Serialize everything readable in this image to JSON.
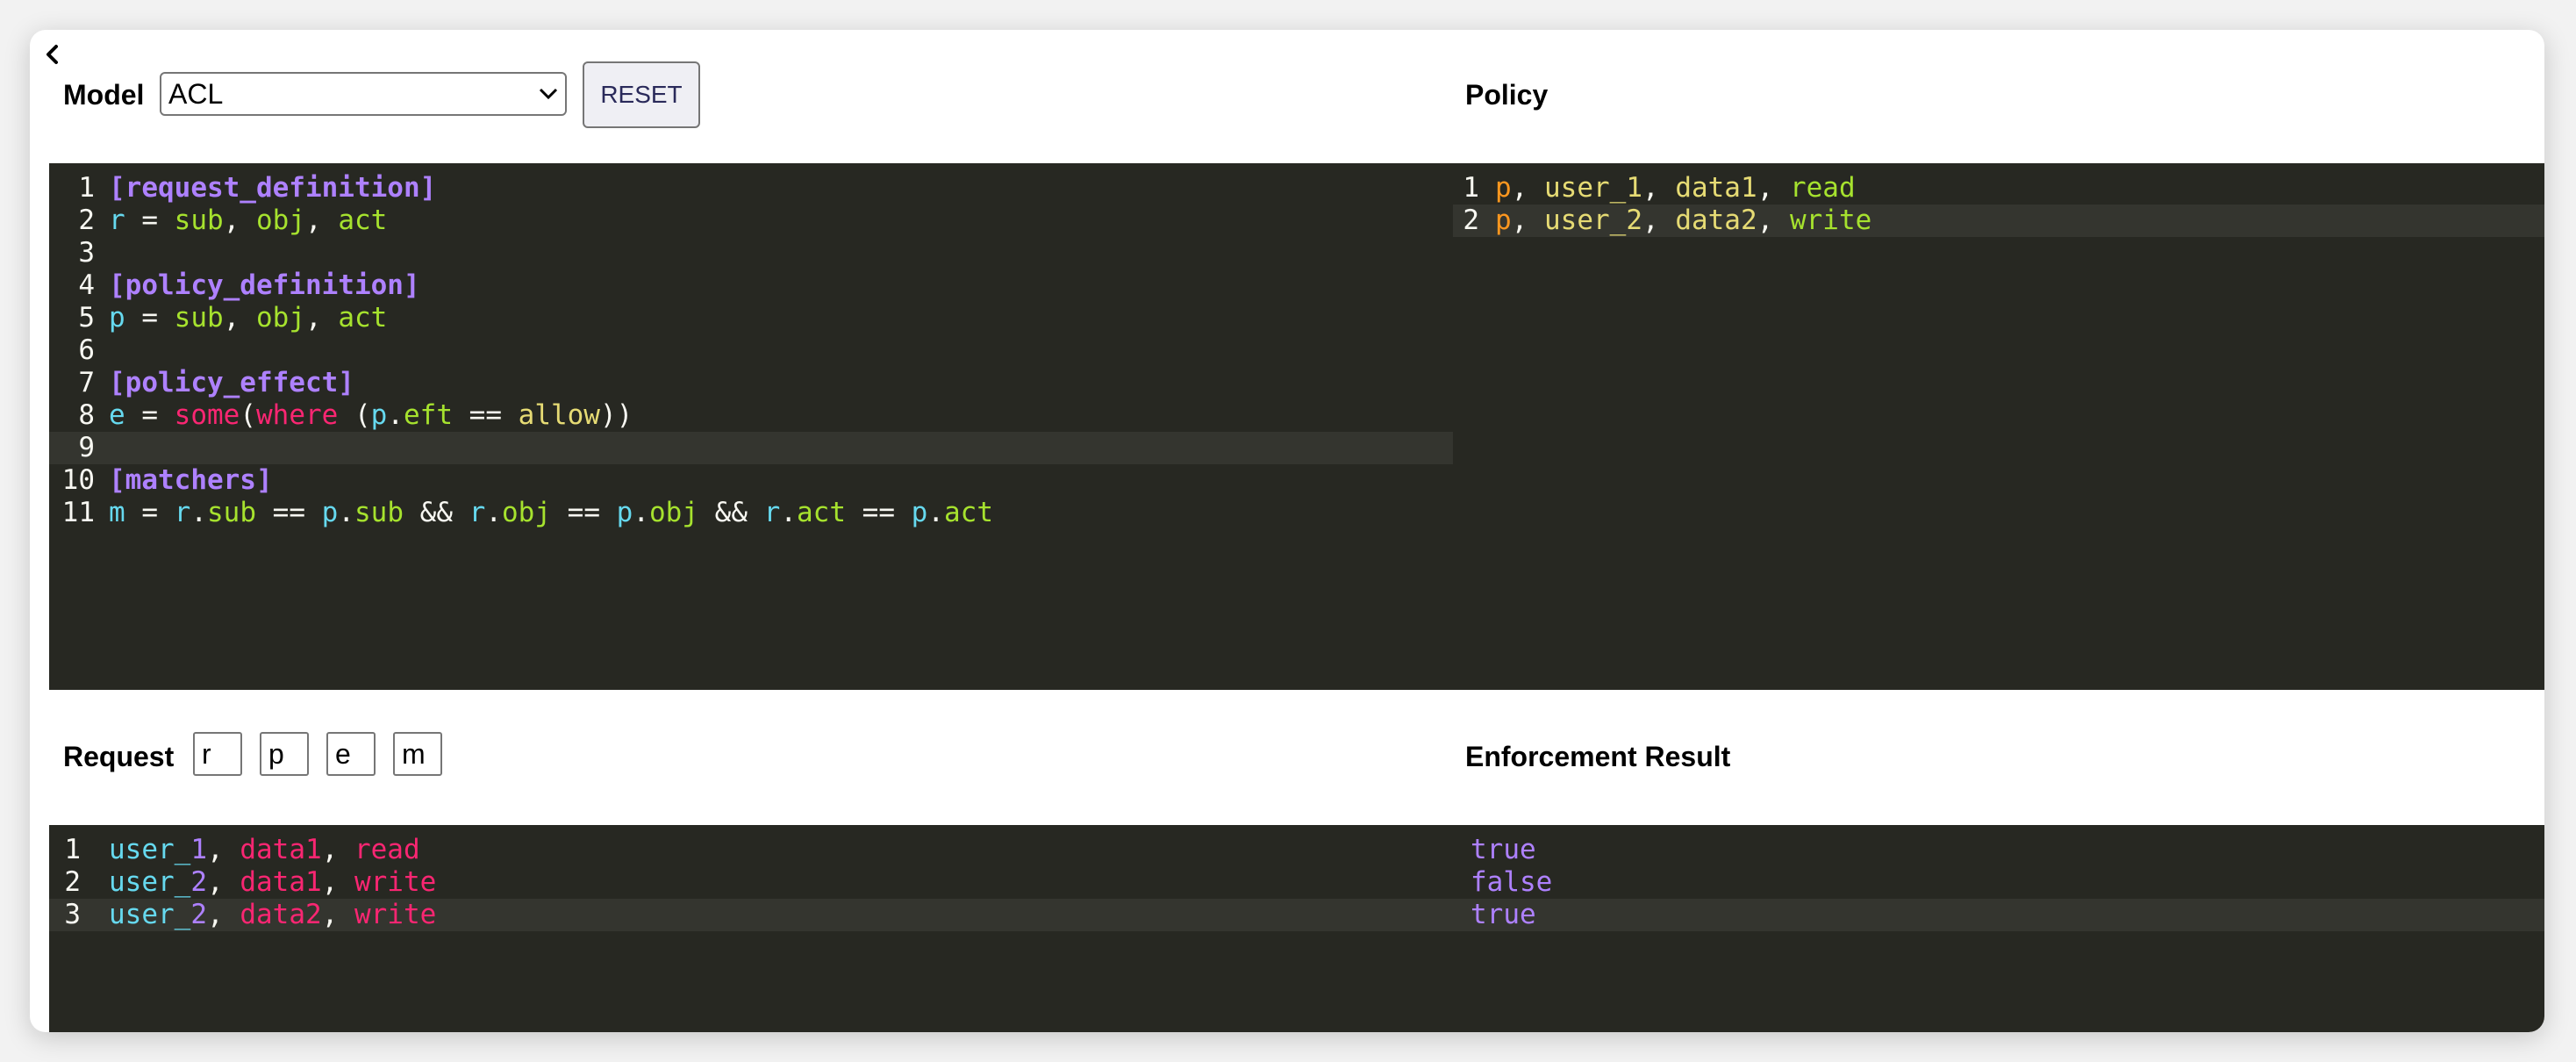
{
  "header": {
    "model_label": "Model",
    "model_selected": "ACL",
    "reset_label": "RESET",
    "policy_label": "Policy"
  },
  "model_editor": {
    "lines": [
      {
        "num": "1",
        "tokens": [
          {
            "t": "[request_definition]",
            "c": "sec"
          }
        ]
      },
      {
        "num": "2",
        "tokens": [
          {
            "t": "r",
            "c": "c"
          },
          {
            "t": " = ",
            "c": ""
          },
          {
            "t": "sub",
            "c": "g"
          },
          {
            "t": ", ",
            "c": ""
          },
          {
            "t": "obj",
            "c": "g"
          },
          {
            "t": ", ",
            "c": ""
          },
          {
            "t": "act",
            "c": "g"
          }
        ]
      },
      {
        "num": "3",
        "tokens": []
      },
      {
        "num": "4",
        "tokens": [
          {
            "t": "[policy_definition]",
            "c": "sec"
          }
        ]
      },
      {
        "num": "5",
        "tokens": [
          {
            "t": "p",
            "c": "c"
          },
          {
            "t": " = ",
            "c": ""
          },
          {
            "t": "sub",
            "c": "g"
          },
          {
            "t": ", ",
            "c": ""
          },
          {
            "t": "obj",
            "c": "g"
          },
          {
            "t": ", ",
            "c": ""
          },
          {
            "t": "act",
            "c": "g"
          }
        ]
      },
      {
        "num": "6",
        "tokens": []
      },
      {
        "num": "7",
        "tokens": [
          {
            "t": "[policy_effect]",
            "c": "sec"
          }
        ]
      },
      {
        "num": "8",
        "tokens": [
          {
            "t": "e",
            "c": "c"
          },
          {
            "t": " = ",
            "c": ""
          },
          {
            "t": "some",
            "c": "pink"
          },
          {
            "t": "(",
            "c": ""
          },
          {
            "t": "where",
            "c": "pink"
          },
          {
            "t": " (",
            "c": ""
          },
          {
            "t": "p",
            "c": "c"
          },
          {
            "t": ".",
            "c": ""
          },
          {
            "t": "eft",
            "c": "g"
          },
          {
            "t": " == ",
            "c": ""
          },
          {
            "t": "allow",
            "c": "y"
          },
          {
            "t": "))",
            "c": ""
          }
        ]
      },
      {
        "num": "9",
        "tokens": [],
        "active": true
      },
      {
        "num": "10",
        "tokens": [
          {
            "t": "[matchers]",
            "c": "sec"
          }
        ]
      },
      {
        "num": "11",
        "tokens": [
          {
            "t": "m",
            "c": "c"
          },
          {
            "t": " = ",
            "c": ""
          },
          {
            "t": "r",
            "c": "c"
          },
          {
            "t": ".",
            "c": ""
          },
          {
            "t": "sub",
            "c": "g"
          },
          {
            "t": " == ",
            "c": ""
          },
          {
            "t": "p",
            "c": "c"
          },
          {
            "t": ".",
            "c": ""
          },
          {
            "t": "sub",
            "c": "g"
          },
          {
            "t": " && ",
            "c": ""
          },
          {
            "t": "r",
            "c": "c"
          },
          {
            "t": ".",
            "c": ""
          },
          {
            "t": "obj",
            "c": "g"
          },
          {
            "t": " == ",
            "c": ""
          },
          {
            "t": "p",
            "c": "c"
          },
          {
            "t": ".",
            "c": ""
          },
          {
            "t": "obj",
            "c": "g"
          },
          {
            "t": " && ",
            "c": ""
          },
          {
            "t": "r",
            "c": "c"
          },
          {
            "t": ".",
            "c": ""
          },
          {
            "t": "act",
            "c": "g"
          },
          {
            "t": " == ",
            "c": ""
          },
          {
            "t": "p",
            "c": "c"
          },
          {
            "t": ".",
            "c": ""
          },
          {
            "t": "act",
            "c": "g"
          }
        ]
      }
    ]
  },
  "policy_editor": {
    "lines": [
      {
        "num": "1",
        "tokens": [
          {
            "t": "p",
            "c": "o"
          },
          {
            "t": ", ",
            "c": ""
          },
          {
            "t": "user_1",
            "c": "y"
          },
          {
            "t": ", ",
            "c": ""
          },
          {
            "t": "data1",
            "c": "y"
          },
          {
            "t": ", ",
            "c": ""
          },
          {
            "t": "read",
            "c": "g"
          }
        ]
      },
      {
        "num": "2",
        "tokens": [
          {
            "t": "p",
            "c": "o"
          },
          {
            "t": ", ",
            "c": ""
          },
          {
            "t": "user_2",
            "c": "y"
          },
          {
            "t": ", ",
            "c": ""
          },
          {
            "t": "data2",
            "c": "y"
          },
          {
            "t": ", ",
            "c": ""
          },
          {
            "t": "write",
            "c": "g"
          }
        ],
        "active": true
      }
    ]
  },
  "request": {
    "label": "Request",
    "tokens": [
      "r",
      "p",
      "e",
      "m"
    ]
  },
  "request_editor": {
    "lines": [
      {
        "num": "1",
        "tokens": [
          {
            "t": "user_",
            "c": "c"
          },
          {
            "t": "1",
            "c": "pu"
          },
          {
            "t": ", ",
            "c": ""
          },
          {
            "t": "data1",
            "c": "pink"
          },
          {
            "t": ", ",
            "c": ""
          },
          {
            "t": "read",
            "c": "pink"
          }
        ]
      },
      {
        "num": "2",
        "tokens": [
          {
            "t": "user_",
            "c": "c"
          },
          {
            "t": "2",
            "c": "pu"
          },
          {
            "t": ", ",
            "c": ""
          },
          {
            "t": "data1",
            "c": "pink"
          },
          {
            "t": ", ",
            "c": ""
          },
          {
            "t": "write",
            "c": "pink"
          }
        ]
      },
      {
        "num": "3",
        "tokens": [
          {
            "t": "user_",
            "c": "c"
          },
          {
            "t": "2",
            "c": "pu"
          },
          {
            "t": ", ",
            "c": ""
          },
          {
            "t": "data2",
            "c": "pink"
          },
          {
            "t": ", ",
            "c": ""
          },
          {
            "t": "write",
            "c": "pink"
          }
        ],
        "active": true
      }
    ]
  },
  "enforcement": {
    "label": "Enforcement Result",
    "results": [
      "true",
      "false",
      "true"
    ]
  },
  "colors": {
    "editor_bg": "#272822",
    "section": "#ae81ff",
    "green": "#a6e22e",
    "cyan": "#66d9ef",
    "pink": "#f92672",
    "yellow": "#e6db74",
    "orange": "#fd971f"
  },
  "icons": {
    "back": "chevron-left-icon",
    "select_arrow": "chevron-down-icon"
  }
}
